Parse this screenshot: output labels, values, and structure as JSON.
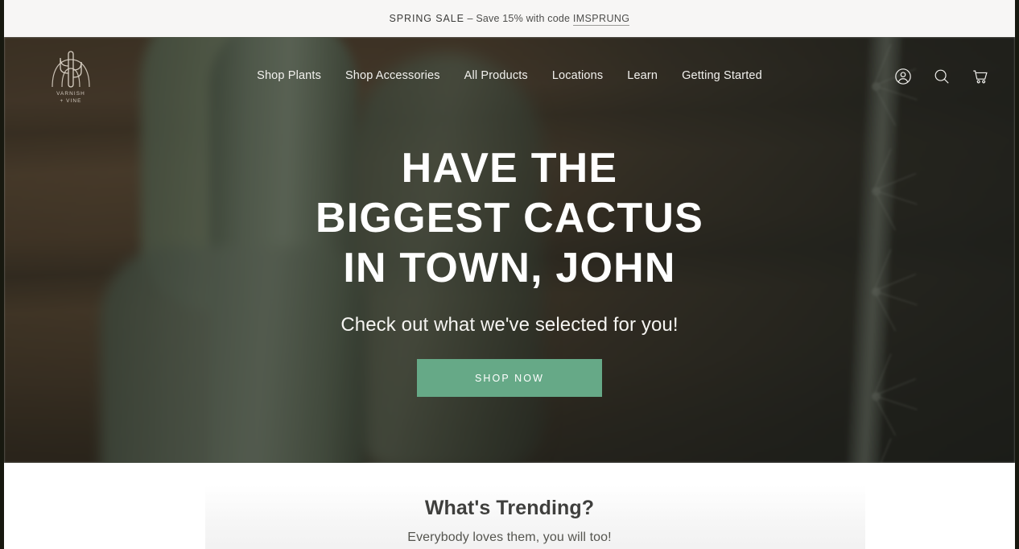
{
  "announcement": {
    "sale_label": "SPRING SALE",
    "separator": " – ",
    "message": "Save 15% with code ",
    "code": "IMSPRUNG"
  },
  "header": {
    "logo": {
      "line1": "VARNISH",
      "line2": "+ VINE",
      "icon": "cactus-arch-logo"
    },
    "nav": [
      {
        "label": "Shop Plants"
      },
      {
        "label": "Shop Accessories"
      },
      {
        "label": "All Products"
      },
      {
        "label": "Locations"
      },
      {
        "label": "Learn"
      },
      {
        "label": "Getting Started"
      }
    ],
    "icons": [
      {
        "name": "account-icon"
      },
      {
        "name": "search-icon"
      },
      {
        "name": "cart-icon"
      }
    ]
  },
  "hero": {
    "title": "Have the biggest cactus in town, John",
    "subtitle": "Check out what we've selected for you!",
    "cta_label": "SHOP NOW",
    "cta_color": "#66a987",
    "overlay_color": "rgba(30,31,27,0.55)"
  },
  "trending": {
    "title": "What's Trending?",
    "subtitle": "Everybody loves them, you will too!"
  }
}
